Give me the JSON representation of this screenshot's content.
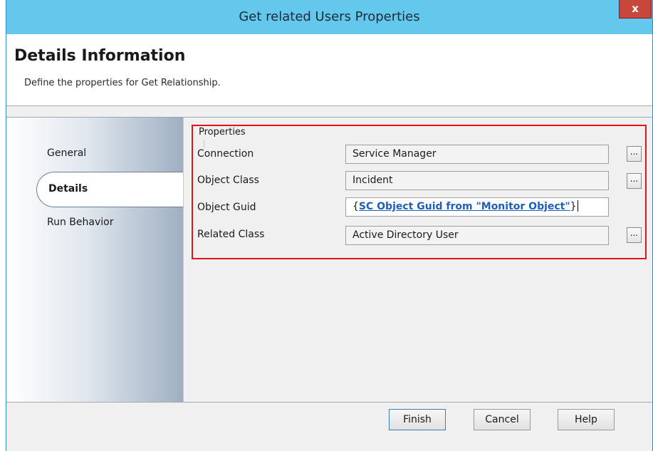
{
  "window": {
    "title": "Get related Users Properties",
    "close_label": "x"
  },
  "header": {
    "title": "Details Information",
    "subtitle": "Define the properties for Get Relationship."
  },
  "sidebar": {
    "items": [
      {
        "label": "General",
        "selected": false
      },
      {
        "label": "Details",
        "selected": true
      },
      {
        "label": "Run Behavior",
        "selected": false
      }
    ]
  },
  "properties": {
    "group_label": "Properties",
    "rows": [
      {
        "label": "Connection",
        "value": "Service Manager",
        "browse_label": "..."
      },
      {
        "label": "Object Class",
        "value": "Incident",
        "browse_label": "..."
      },
      {
        "label": "Object Guid",
        "value_open": "{",
        "value_token": "SC Object Guid from \"Monitor Object\"",
        "value_close": "}"
      },
      {
        "label": "Related Class",
        "value": "Active Directory User",
        "browse_label": "..."
      }
    ]
  },
  "footer": {
    "finish_label": "Finish",
    "cancel_label": "Cancel",
    "help_label": "Help"
  },
  "colors": {
    "titlebar": "#64c8ec",
    "highlight_border": "#e0151c",
    "token_link": "#1f5fb8"
  }
}
